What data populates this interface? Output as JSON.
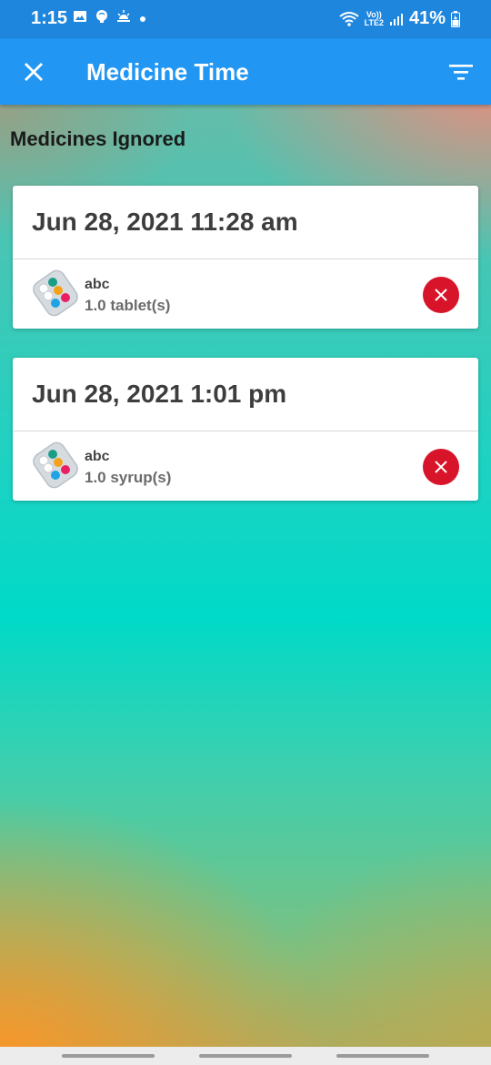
{
  "status_bar": {
    "time": "1:15",
    "battery": "41%",
    "network_top": "Vo))",
    "network_bottom": "LTE2",
    "icons": [
      "image-icon",
      "brain-icon",
      "sunrise-icon",
      "dot-icon",
      "wifi-icon",
      "signal-icon",
      "battery-icon"
    ]
  },
  "app_bar": {
    "title": "Medicine Time",
    "close_icon": "close-icon",
    "filter_icon": "filter-icon",
    "color": "#2196f3"
  },
  "section": {
    "title": "Medicines Ignored"
  },
  "records": [
    {
      "date": "Jun 28, 2021 11:28 am",
      "name": "abc",
      "dose": "1.0 tablet(s)"
    },
    {
      "date": "Jun 28, 2021 1:01 pm",
      "name": "abc",
      "dose": "1.0 syrup(s)"
    }
  ],
  "colors": {
    "delete": "#d7142a",
    "status_bar": "#1f86de"
  }
}
